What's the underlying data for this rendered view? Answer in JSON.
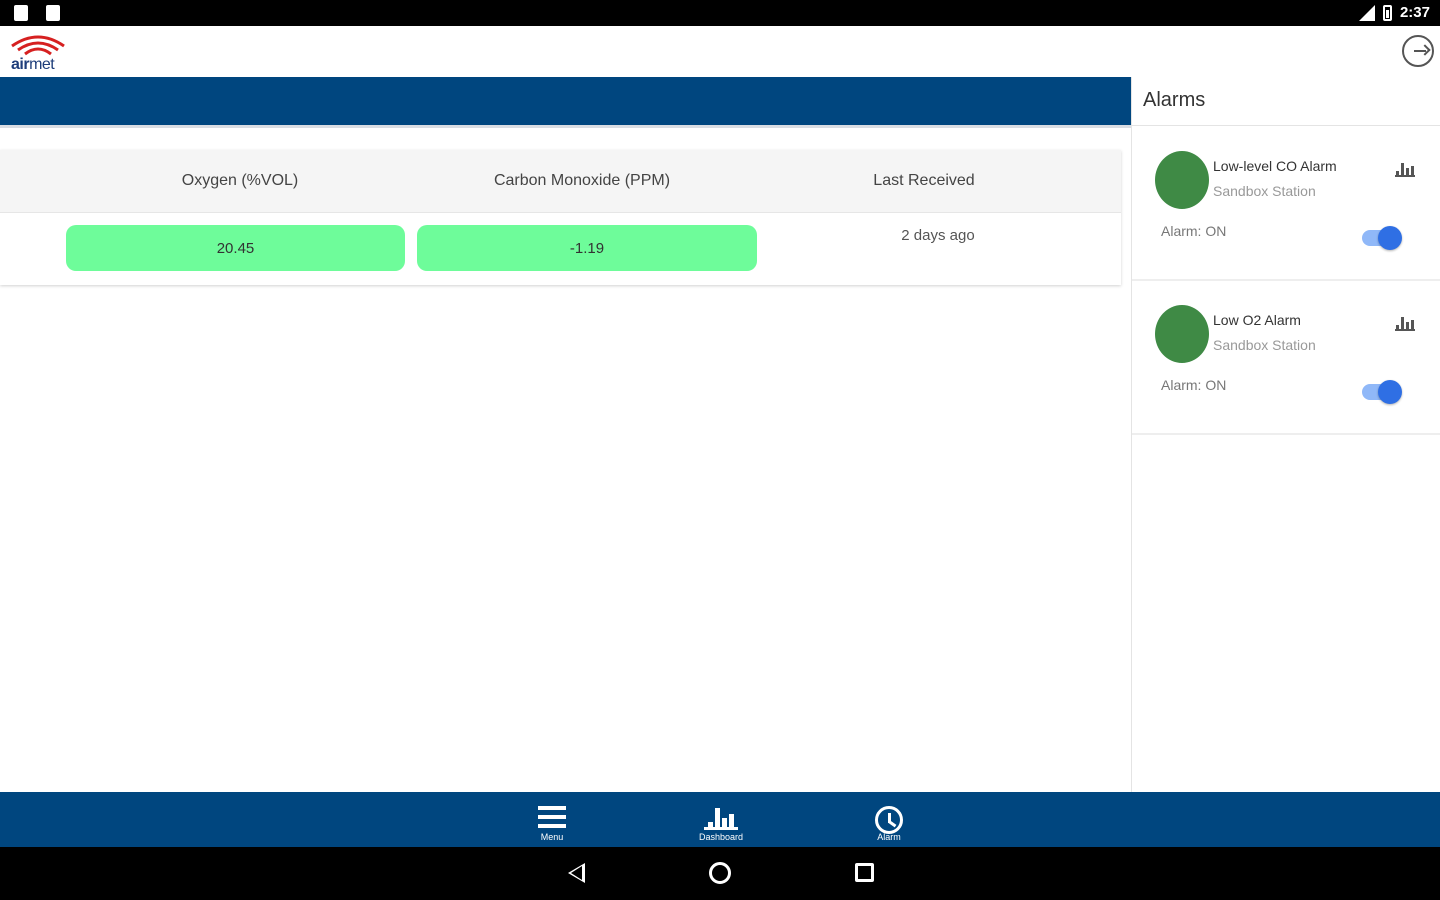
{
  "status_bar": {
    "time": "2:37"
  },
  "app": {
    "logo_bold": "air",
    "logo_light": "met"
  },
  "table": {
    "headers": [
      "Oxygen (%VOL)",
      "Carbon Monoxide (PPM)",
      "Last Received"
    ],
    "row": {
      "oxygen": "20.45",
      "carbon_monoxide": "-1.19",
      "last_received": "2 days ago"
    },
    "pill_color": "#6efc9a"
  },
  "alarms_panel": {
    "title": "Alarms",
    "items": [
      {
        "name": "Low-level CO Alarm",
        "station": "Sandbox Station",
        "state": "Alarm: ON",
        "enabled": true
      },
      {
        "name": "Low O2 Alarm",
        "station": "Sandbox Station",
        "state": "Alarm: ON",
        "enabled": true
      }
    ]
  },
  "bottom_nav": {
    "items": [
      {
        "label": "Menu",
        "icon": "menu-icon"
      },
      {
        "label": "Dashboard",
        "icon": "bar-chart-icon"
      },
      {
        "label": "Alarm",
        "icon": "alarm-clock-icon"
      }
    ]
  },
  "colors": {
    "primary_blue": "#00467f",
    "alarm_green": "#3f8a45",
    "toggle_blue": "#2f6fe4"
  }
}
